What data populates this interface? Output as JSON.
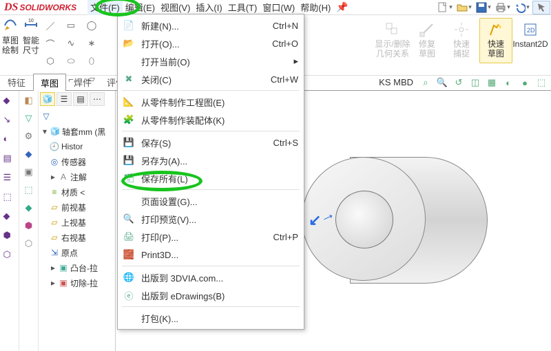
{
  "brand": {
    "ds": "DS",
    "name": "SOLIDWORKS"
  },
  "menus": [
    {
      "id": "file",
      "label": "文件(F)",
      "active": true
    },
    {
      "id": "edit",
      "label": "编辑(E)"
    },
    {
      "id": "view",
      "label": "视图(V)"
    },
    {
      "id": "insert",
      "label": "插入(I)"
    },
    {
      "id": "tools",
      "label": "工具(T)"
    },
    {
      "id": "window",
      "label": "窗口(W)"
    },
    {
      "id": "help",
      "label": "帮助(H)"
    }
  ],
  "file_menu": [
    {
      "icon": "new",
      "label": "新建(N)...",
      "shortcut": "Ctrl+N"
    },
    {
      "icon": "open",
      "label": "打开(O)...",
      "shortcut": "Ctrl+O"
    },
    {
      "icon": "",
      "label": "打开当前(O)",
      "submenu": true
    },
    {
      "icon": "close",
      "label": "关闭(C)",
      "shortcut": "Ctrl+W"
    },
    "sep",
    {
      "icon": "drawing",
      "label": "从零件制作工程图(E)"
    },
    {
      "icon": "assembly",
      "label": "从零件制作装配体(K)"
    },
    "sep",
    {
      "icon": "save",
      "label": "保存(S)",
      "shortcut": "Ctrl+S"
    },
    {
      "icon": "saveas",
      "label": "另存为(A)...",
      "highlight": true
    },
    {
      "icon": "saveall",
      "label": "保存所有(L)"
    },
    "sep",
    {
      "icon": "",
      "label": "页面设置(G)..."
    },
    {
      "icon": "preview",
      "label": "打印预览(V)..."
    },
    {
      "icon": "print",
      "label": "打印(P)...",
      "shortcut": "Ctrl+P"
    },
    {
      "icon": "print3d",
      "label": "Print3D..."
    },
    "sep",
    {
      "icon": "publish",
      "label": "出版到 3DVIA.com..."
    },
    {
      "icon": "edrawings",
      "label": "出版到 eDrawings(B)"
    },
    "sep",
    {
      "icon": "",
      "label": "打包(K)..."
    }
  ],
  "left_tools": {
    "sketch": "草图\n绘制",
    "smart_dim": "智能\n尺寸"
  },
  "ribbon_right": [
    {
      "id": "show-delete-rel",
      "label": "显示/删除\n几何关系",
      "disabled": true
    },
    {
      "id": "repair-sketch",
      "label": "修复\n草图",
      "disabled": true
    },
    {
      "id": "quick-snap",
      "label": "快速\n捕捉",
      "disabled": true
    },
    {
      "id": "quick-sketch",
      "label": "快速\n草图",
      "active": true
    },
    {
      "id": "instant2d",
      "label": "Instant2D"
    }
  ],
  "tabs": [
    {
      "id": "feature",
      "label": "特征"
    },
    {
      "id": "sketch",
      "label": "草图",
      "active": true
    },
    {
      "id": "weldment",
      "label": "焊件"
    },
    {
      "id": "evaluate",
      "label": "评估"
    }
  ],
  "tabs_right_label": "KS MBD",
  "tree": {
    "root": "轴套mm (黑",
    "history": "Histor",
    "sensors": "传感器",
    "annotations": "注解",
    "material": "材质 <",
    "front_plane": "前视基",
    "top_plane": "上视基",
    "right_plane": "右视基",
    "origin": "原点",
    "boss": "凸台-拉",
    "cut": "切除-拉"
  }
}
